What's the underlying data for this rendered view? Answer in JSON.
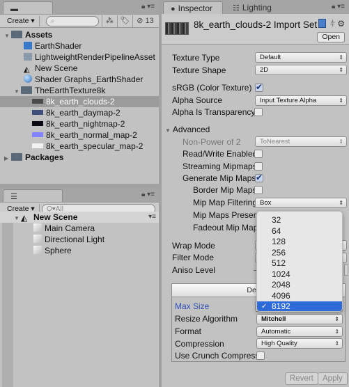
{
  "project": {
    "tab_label": "Project",
    "tab_icon": "folder-icon",
    "create_label": "Create ▾",
    "search_placeholder": "",
    "hidden_count": "13",
    "tree": [
      {
        "label": "Assets",
        "type": "folder",
        "bold": true,
        "expanded": true
      },
      {
        "label": "EarthShader",
        "type": "shader"
      },
      {
        "label": "LightweightRenderPipelineAsset",
        "type": "asset"
      },
      {
        "label": "New Scene",
        "type": "scene"
      },
      {
        "label": "Shader Graphs_EarthShader",
        "type": "material"
      },
      {
        "label": "TheEarthTexture8k",
        "type": "folder",
        "expanded": true
      },
      {
        "label": "8k_earth_clouds-2",
        "type": "texture",
        "selected": true
      },
      {
        "label": "8k_earth_daymap-2",
        "type": "texture"
      },
      {
        "label": "8k_earth_nightmap-2",
        "type": "texture"
      },
      {
        "label": "8k_earth_normal_map-2",
        "type": "texture"
      },
      {
        "label": "8k_earth_specular_map-2",
        "type": "texture"
      },
      {
        "label": "Packages",
        "type": "folder",
        "bold": true,
        "expanded": false
      }
    ]
  },
  "hierarchy": {
    "tab_label": "Hierarchy",
    "create_label": "Create ▾",
    "search_placeholder": "Q▾All",
    "scene": "New Scene",
    "objects": [
      "Main Camera",
      "Directional Light",
      "Sphere"
    ]
  },
  "inspector": {
    "tab_label": "Inspector",
    "lighting_tab_label": "Lighting",
    "title": "8k_earth_clouds-2 Import Set",
    "open_label": "Open",
    "texture_type_label": "Texture Type",
    "texture_type_value": "Default",
    "texture_shape_label": "Texture Shape",
    "texture_shape_value": "2D",
    "srgb_label": "sRGB (Color Texture)",
    "srgb_checked": true,
    "alpha_source_label": "Alpha Source",
    "alpha_source_value": "Input Texture Alpha",
    "alpha_transparency_label": "Alpha Is Transparency",
    "alpha_transparency_checked": false,
    "advanced_label": "Advanced",
    "npot_label": "Non-Power of 2",
    "npot_value": "ToNearest",
    "read_write_label": "Read/Write Enabled",
    "read_write_checked": false,
    "streaming_label": "Streaming Mipmaps",
    "streaming_checked": false,
    "gen_mip_label": "Generate Mip Maps",
    "gen_mip_checked": true,
    "border_mip_label": "Border Mip Maps",
    "border_mip_checked": false,
    "mip_filter_label": "Mip Map Filtering",
    "mip_filter_value": "Box",
    "mip_preserve_label": "Mip Maps Preserv",
    "fadeout_label": "Fadeout Mip Map",
    "wrap_label": "Wrap Mode",
    "filter_label": "Filter Mode",
    "aniso_label": "Aniso Level",
    "platform_tab_label": "Default",
    "max_size_label": "Max Size",
    "resize_label": "Resize Algorithm",
    "resize_value": "Mitchell",
    "format_label": "Format",
    "format_value": "Automatic",
    "compression_label": "Compression",
    "compression_value": "High Quality",
    "crunch_label": "Use Crunch Compressi",
    "crunch_checked": false,
    "revert_label": "Revert",
    "apply_label": "Apply"
  },
  "max_size_popup": {
    "options": [
      "32",
      "64",
      "128",
      "256",
      "512",
      "1024",
      "2048",
      "4096",
      "8192"
    ],
    "selected": "8192",
    "check_glyph": "✓"
  }
}
